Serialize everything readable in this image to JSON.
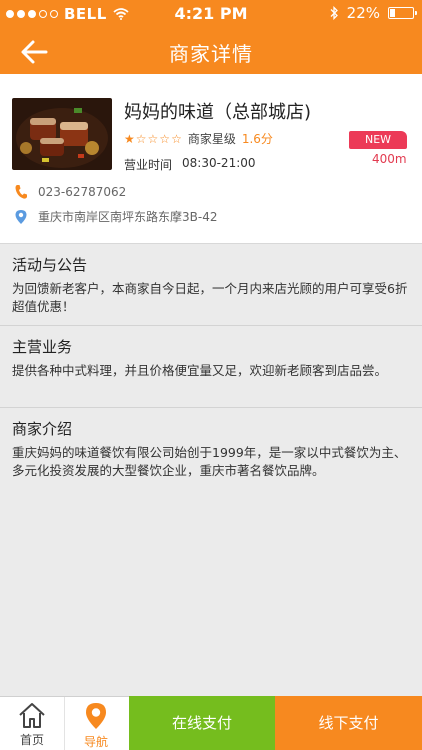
{
  "status_bar": {
    "carrier": "BELL",
    "time": "4:21 PM",
    "battery": "22%",
    "battery_level": 0.22
  },
  "nav": {
    "title": "商家详情"
  },
  "shop": {
    "name": "妈妈的味道（总部城店)",
    "rating_label": "商家星级",
    "rating_value": "1.6分",
    "rating_stars": 1,
    "hours_label": "营业时间",
    "hours_value": "08:30-21:00",
    "badge": "NEW",
    "distance": "400m",
    "phone": "023-62787062",
    "address": "重庆市南岸区南坪东路东摩3B-42"
  },
  "sections": [
    {
      "title": "活动与公告",
      "body": "为回馈新老客户，本商家自今日起，一个月内来店光顾的用户可享受6折超值优惠！"
    },
    {
      "title": "主营业务",
      "body": "提供各种中式料理，并且价格便宜量又足，欢迎新老顾客到店品尝。"
    },
    {
      "title": "商家介绍",
      "body": "重庆妈妈的味道餐饮有限公司始创于1999年，是一家以中式餐饮为主、多元化投资发展的大型餐饮企业，重庆市著名餐饮品牌。"
    }
  ],
  "tabbar": {
    "home": "首页",
    "navigate": "导航",
    "pay_online": "在线支付",
    "pay_offline": "线下支付"
  },
  "colors": {
    "brand_orange": "#f7891f",
    "green": "#75bd1e",
    "badge_red": "#ec3a57"
  }
}
